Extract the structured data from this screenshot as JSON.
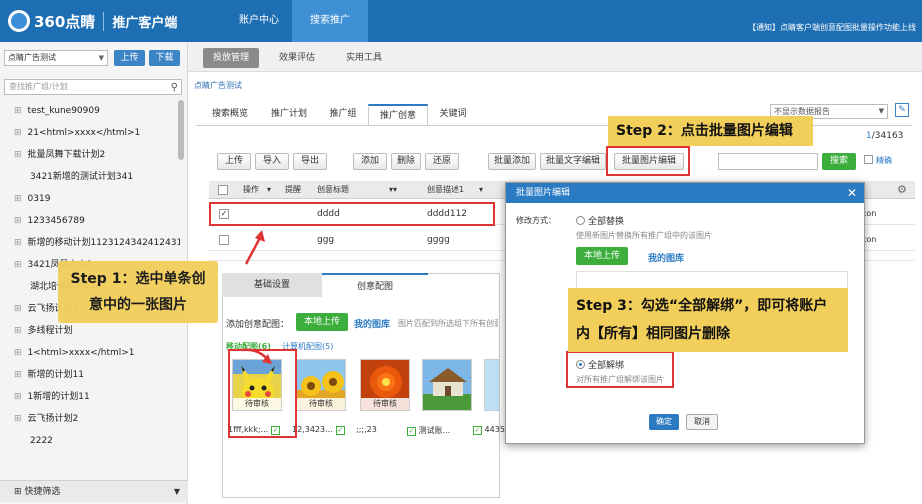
{
  "header": {
    "logo_brand": "360点睛",
    "logo_sub": "推广客户端",
    "nav": [
      "账户中心",
      "搜索推广"
    ],
    "notice": "【通知】点睛客户端创意配图批量操作功能上线"
  },
  "sidebar": {
    "account_select": "点睛广告测试",
    "upload": "上传",
    "download": "下载",
    "search_placeholder": "查找推广组/计划",
    "plans": [
      "test_kune90909",
      "21<html>xxxx</html>1",
      "批量凤舞下载计划2",
      "3421新增的测试计划341",
      "0319",
      "1233456789",
      "新增的移动计划1123124342412431",
      "3421凤凤火火1",
      "湖北培训实训4441",
      "云飞扬计划3",
      "多线程计划",
      "1<html>xxxx</html>1",
      "新增的计划11",
      "1新增的计划11",
      "云飞扬计划2",
      "2222"
    ],
    "quick_filter": "快捷筛选"
  },
  "subnav": [
    "投放管理",
    "效果评估",
    "实用工具"
  ],
  "breadcrumb": "点睛广告测试",
  "display_select": "不显示数据报告",
  "tabs": [
    "搜索概览",
    "推广计划",
    "推广组",
    "推广创意",
    "关键词"
  ],
  "pager": {
    "current": "1",
    "total": "/34163"
  },
  "toolbar": [
    "上传",
    "导入",
    "导出",
    "添加",
    "删除",
    "还原",
    "批量添加",
    "批量文字编辑",
    "批量图片编辑"
  ],
  "search_btn": "搜索",
  "exact": "精确",
  "table": {
    "headers": [
      "操作",
      "提醒",
      "创意标题",
      "创意描述1"
    ],
    "rows": [
      {
        "title": "dddd",
        "desc": "dddd112",
        "checked": true
      },
      {
        "title": "ggg",
        "desc": "gggg",
        "checked": false
      },
      {
        "title": "ʼʼʼʼʼʼʼ",
        "desc": "",
        "checked": false
      }
    ],
    "partial": "con"
  },
  "panel": {
    "tabs": [
      "基础设置",
      "创意配图"
    ],
    "add_label": "添加创意配图：",
    "local_upload": "本地上传",
    "my_library": "我的图库",
    "hint": "图片匹配到所选组下所有创意",
    "subtabs": [
      "移动配图(6)",
      "计算机配图(5)"
    ],
    "thumbs": [
      {
        "status": "待审核",
        "name": "1fff,kkk;..."
      },
      {
        "status": "待审核",
        "name": "12,3423..."
      },
      {
        "status": "待审核",
        "name": ";;;,23"
      },
      {
        "status": "",
        "name": "测试账..."
      },
      {
        "status": "",
        "name": "4435"
      }
    ]
  },
  "dialog": {
    "title": "批量图片编辑",
    "mode_label": "修改方式：",
    "replace_all": "全部替换",
    "replace_desc": "使用新图片替换所有推广组中的该图片",
    "local_upload": "本地上传",
    "my_library": "我的图库",
    "unbind_all": "全部解绑",
    "unbind_desc": "对所有推广组解绑该图片",
    "ok": "确定",
    "cancel": "取消"
  },
  "annotations": {
    "step1": "Step 1：选中单条创意中的一张图片",
    "step2": "Step 2：点击批量图片编辑",
    "step3": "Step 3：勾选“全部解绑”，即可将账户内【所有】相同图片删除"
  }
}
